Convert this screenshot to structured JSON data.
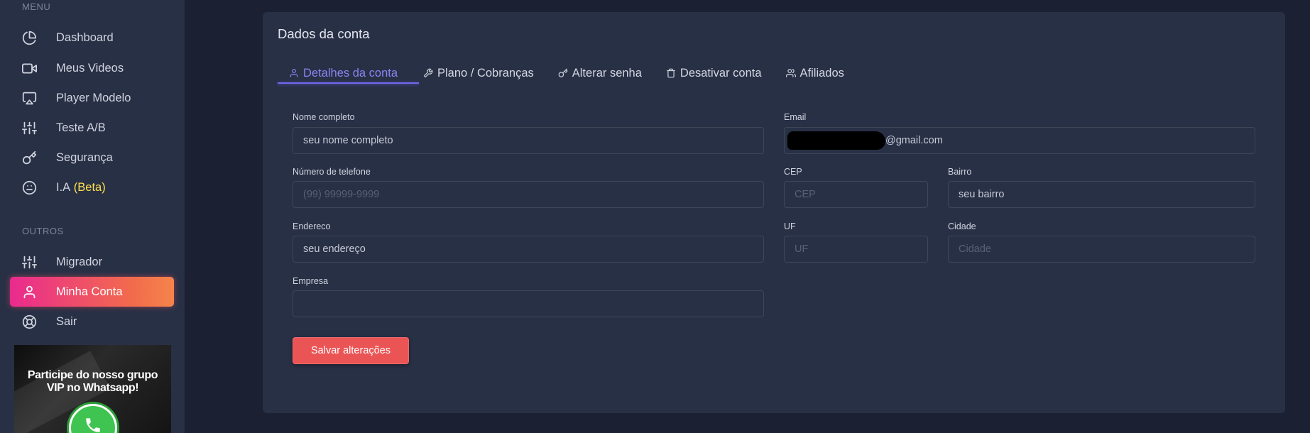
{
  "sidebar": {
    "menu_title": "MENU",
    "menu_items": [
      {
        "label": "Dashboard",
        "icon": "pie-chart-icon"
      },
      {
        "label": "Meus Videos",
        "icon": "video-icon"
      },
      {
        "label": "Player Modelo",
        "icon": "airplay-icon"
      },
      {
        "label": "Teste A/B",
        "icon": "sliders-icon"
      },
      {
        "label": "Segurança",
        "icon": "key-icon"
      },
      {
        "label": "I.A",
        "badge": "(Beta)",
        "icon": "smile-icon"
      }
    ],
    "others_title": "OUTROS",
    "other_items": [
      {
        "label": "Migrador",
        "icon": "sliders-icon"
      },
      {
        "label": "Minha Conta",
        "icon": "user-icon",
        "active": true
      },
      {
        "label": "Sair",
        "icon": "life-buoy-icon"
      }
    ],
    "banner": {
      "line1": "Participe do nosso grupo",
      "line2": "VIP no Whatsapp!",
      "icon": "whatsapp-icon"
    }
  },
  "card": {
    "title": "Dados da conta",
    "tabs": [
      {
        "label": "Detalhes da conta",
        "icon": "user-icon",
        "active": true
      },
      {
        "label": "Plano / Cobranças",
        "icon": "tool-icon"
      },
      {
        "label": "Alterar senha",
        "icon": "key-icon"
      },
      {
        "label": "Desativar conta",
        "icon": "trash-icon"
      },
      {
        "label": "Afiliados",
        "icon": "users-icon"
      }
    ]
  },
  "form": {
    "nome": {
      "label": "Nome completo",
      "value": "seu nome completo"
    },
    "email": {
      "label": "Email",
      "value": "@gmail.com"
    },
    "telefone": {
      "label": "Número de telefone",
      "placeholder": "(99) 99999-9999"
    },
    "cep": {
      "label": "CEP",
      "placeholder": "CEP"
    },
    "bairro": {
      "label": "Bairro",
      "value": "seu bairro"
    },
    "endereco": {
      "label": "Endereco",
      "value": "seu endereço"
    },
    "uf": {
      "label": "UF",
      "placeholder": "UF"
    },
    "cidade": {
      "label": "Cidade",
      "placeholder": "Cidade"
    },
    "empresa": {
      "label": "Empresa",
      "value": ""
    },
    "save_label": "Salvar alterações"
  },
  "colors": {
    "accent": "#7367f0",
    "danger": "#ea5455",
    "gradient_start": "#ea2a8f",
    "gradient_end": "#f5844a",
    "beta": "#ffe04f"
  }
}
